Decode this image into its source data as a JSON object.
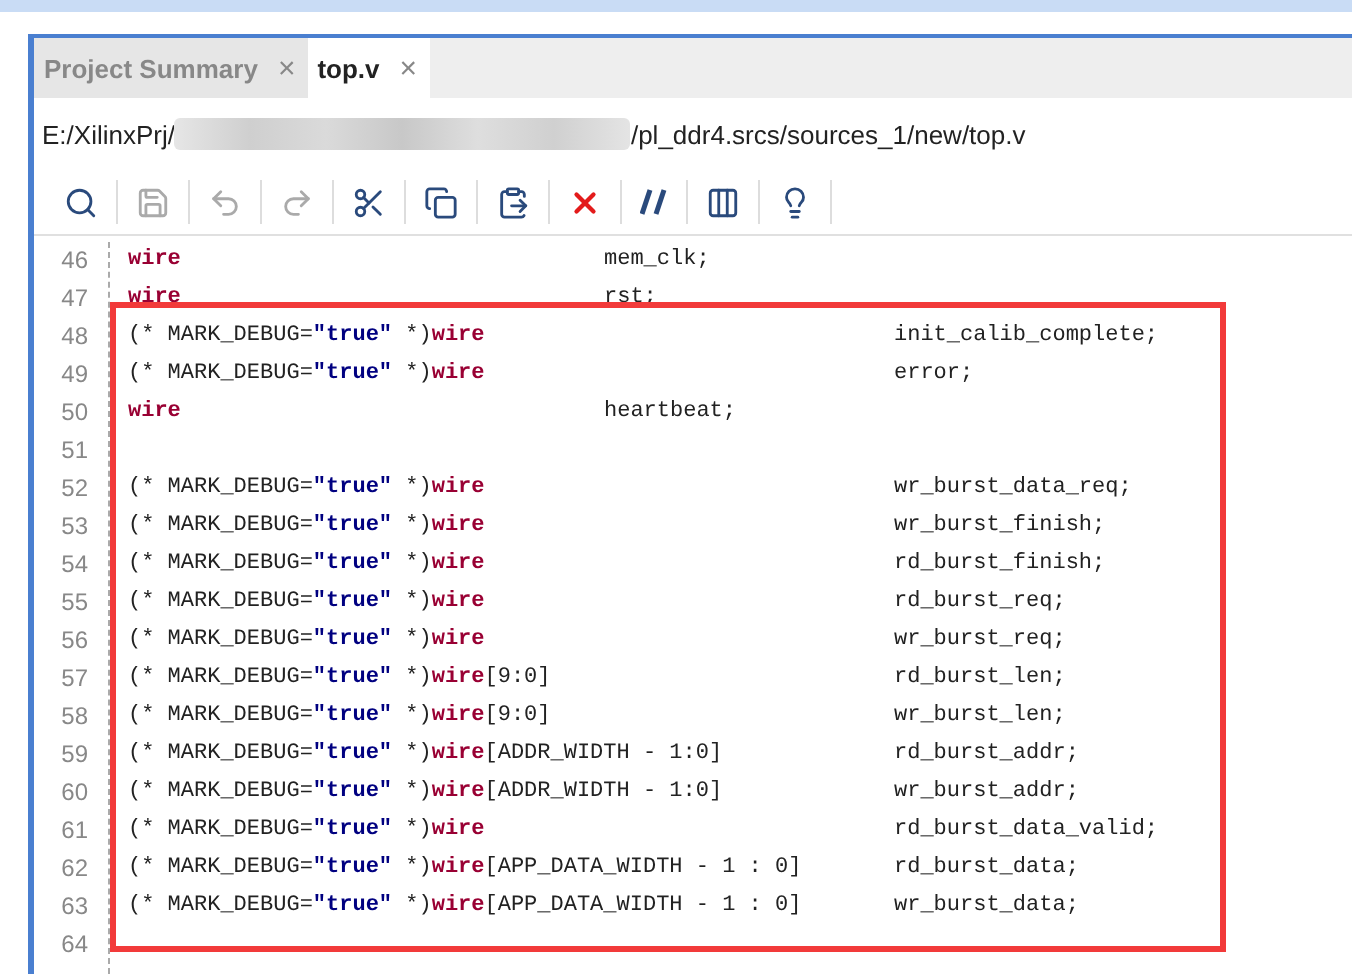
{
  "tabs": [
    {
      "label": "Project Summary",
      "selected": false,
      "close": "×"
    },
    {
      "label": "top.v",
      "selected": true,
      "close": "×"
    }
  ],
  "path": {
    "prefix": "E:/XilinxPrj/",
    "suffix": "/pl_ddr4.srcs/sources_1/new/top.v"
  },
  "toolbar": [
    {
      "kind": "search",
      "disabled": false
    },
    {
      "kind": "save",
      "disabled": true
    },
    {
      "kind": "undo",
      "disabled": true
    },
    {
      "kind": "redo",
      "disabled": true
    },
    {
      "kind": "cut",
      "disabled": false
    },
    {
      "kind": "copy",
      "disabled": false
    },
    {
      "kind": "paste",
      "disabled": false
    },
    {
      "kind": "delete",
      "disabled": false
    },
    {
      "kind": "comment",
      "disabled": false
    },
    {
      "kind": "columns",
      "disabled": false
    },
    {
      "kind": "hint",
      "disabled": false
    }
  ],
  "code": [
    {
      "number": "46",
      "keyword": "wire",
      "name": "mem_clk;"
    },
    {
      "number": "47",
      "keyword": "wire",
      "name": "rst;"
    },
    {
      "number": "48",
      "attribute": {
        "open": "(* MARK_DEBUG=",
        "value": "\"true\"",
        "close": " *)"
      },
      "keyword": "wire",
      "name": "init_calib_complete;"
    },
    {
      "number": "49",
      "attribute": {
        "open": "(* MARK_DEBUG=",
        "value": "\"true\"",
        "close": " *)"
      },
      "keyword": "wire",
      "name": "error;"
    },
    {
      "number": "50",
      "keyword": "wire",
      "name": "heartbeat;"
    },
    {
      "number": "51"
    },
    {
      "number": "52",
      "attribute": {
        "open": "(* MARK_DEBUG=",
        "value": "\"true\"",
        "close": " *)"
      },
      "keyword": "wire",
      "name": "wr_burst_data_req;"
    },
    {
      "number": "53",
      "attribute": {
        "open": "(* MARK_DEBUG=",
        "value": "\"true\"",
        "close": " *)"
      },
      "keyword": "wire",
      "name": "wr_burst_finish;"
    },
    {
      "number": "54",
      "attribute": {
        "open": "(* MARK_DEBUG=",
        "value": "\"true\"",
        "close": " *)"
      },
      "keyword": "wire",
      "name": "rd_burst_finish;"
    },
    {
      "number": "55",
      "attribute": {
        "open": "(* MARK_DEBUG=",
        "value": "\"true\"",
        "close": " *)"
      },
      "keyword": "wire",
      "name": "rd_burst_req;"
    },
    {
      "number": "56",
      "attribute": {
        "open": "(* MARK_DEBUG=",
        "value": "\"true\"",
        "close": " *)"
      },
      "keyword": "wire",
      "name": "wr_burst_req;"
    },
    {
      "number": "57",
      "attribute": {
        "open": "(* MARK_DEBUG=",
        "value": "\"true\"",
        "close": " *)"
      },
      "keyword": "wire",
      "range": "[9:0]",
      "name": "rd_burst_len;"
    },
    {
      "number": "58",
      "attribute": {
        "open": "(* MARK_DEBUG=",
        "value": "\"true\"",
        "close": " *)"
      },
      "keyword": "wire",
      "range": "[9:0]",
      "name": "wr_burst_len;"
    },
    {
      "number": "59",
      "attribute": {
        "open": "(* MARK_DEBUG=",
        "value": "\"true\"",
        "close": " *)"
      },
      "keyword": "wire",
      "range": "[ADDR_WIDTH - 1:0]",
      "name": "rd_burst_addr;"
    },
    {
      "number": "60",
      "attribute": {
        "open": "(* MARK_DEBUG=",
        "value": "\"true\"",
        "close": " *)"
      },
      "keyword": "wire",
      "range": "[ADDR_WIDTH - 1:0]",
      "name": "wr_burst_addr;"
    },
    {
      "number": "61",
      "attribute": {
        "open": "(* MARK_DEBUG=",
        "value": "\"true\"",
        "close": " *)"
      },
      "keyword": "wire",
      "name": "rd_burst_data_valid;"
    },
    {
      "number": "62",
      "attribute": {
        "open": "(* MARK_DEBUG=",
        "value": "\"true\"",
        "close": " *)"
      },
      "keyword": "wire",
      "range": "[APP_DATA_WIDTH - 1 : 0]",
      "name": "rd_burst_data;"
    },
    {
      "number": "63",
      "attribute": {
        "open": "(* MARK_DEBUG=",
        "value": "\"true\"",
        "close": " *)"
      },
      "keyword": "wire",
      "range": "[APP_DATA_WIDTH - 1 : 0]",
      "name": "wr_burst_data;"
    },
    {
      "number": "64"
    }
  ]
}
